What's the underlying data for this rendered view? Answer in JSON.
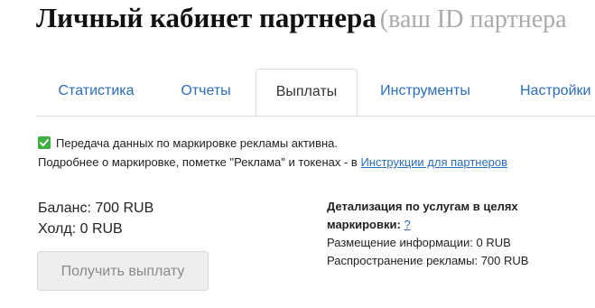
{
  "header": {
    "title": "Личный кабинет партнера",
    "subtitle": "(ваш ID партнера"
  },
  "tabs": [
    {
      "label": "Статистика",
      "active": false
    },
    {
      "label": "Отчеты",
      "active": false
    },
    {
      "label": "Выплаты",
      "active": true
    },
    {
      "label": "Инструменты",
      "active": false
    },
    {
      "label": "Настройки",
      "active": false
    }
  ],
  "notice": {
    "status_text": "Передача данных по маркировке рекламы активна.",
    "info_text": "Подробнее о маркировке, пометке \"Реклама\" и токенах - в ",
    "link_label": "Инструкции для партнеров",
    "icon": "check-icon",
    "icon_color": "#3cb043"
  },
  "balance": {
    "balance_label": "Баланс: 700 RUB",
    "hold_label": "Холд: 0 RUB"
  },
  "payout_button": {
    "label": "Получить выплату",
    "enabled": false
  },
  "details": {
    "heading_line1": "Детализация по услугам в целях",
    "heading_line2": "маркировки:",
    "help_label": "?",
    "placement": "Размещение информации: 0 RUB",
    "distribution": "Распространение рекламы: 700 RUB"
  },
  "colors": {
    "link": "#2a6ebb",
    "title": "#111111",
    "subtitle": "#aaaaaa"
  }
}
